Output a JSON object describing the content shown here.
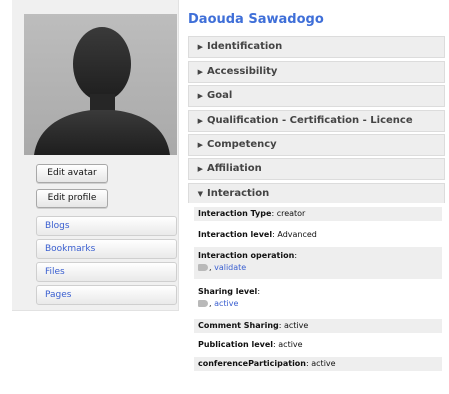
{
  "profile": {
    "name": "Daouda Sawadogo"
  },
  "buttons": {
    "edit_avatar": "Edit avatar",
    "edit_profile": "Edit profile"
  },
  "menu": [
    "Blogs",
    "Bookmarks",
    "Files",
    "Pages"
  ],
  "sections": [
    {
      "label": "Identification",
      "expanded": false
    },
    {
      "label": "Accessibility",
      "expanded": false
    },
    {
      "label": "Goal",
      "expanded": false
    },
    {
      "label": "Qualification - Certification - Licence",
      "expanded": false
    },
    {
      "label": "Competency",
      "expanded": false
    },
    {
      "label": "Affiliation",
      "expanded": false
    },
    {
      "label": "Interaction",
      "expanded": true
    }
  ],
  "interaction": {
    "type_label": "Interaction Type",
    "type_value": "creator",
    "level_label": "Interaction level",
    "level_value": "Advanced",
    "operation_label": "Interaction operation",
    "operation_value": "validate",
    "sharing_label": "Sharing level",
    "sharing_value": "active",
    "comment_label": "Comment Sharing",
    "comment_value": "active",
    "publication_label": "Publication level",
    "publication_value": "active",
    "conference_label": "conferenceParticipation",
    "conference_value": "active",
    "list_separator": ", "
  },
  "icons": {
    "collapsed": "triangle-right-icon",
    "expanded": "triangle-down-icon",
    "tag": "tag-icon"
  },
  "colors": {
    "accent": "#3f6fd8",
    "link": "#3a5fd0",
    "section_bg": "#eeeeee"
  }
}
